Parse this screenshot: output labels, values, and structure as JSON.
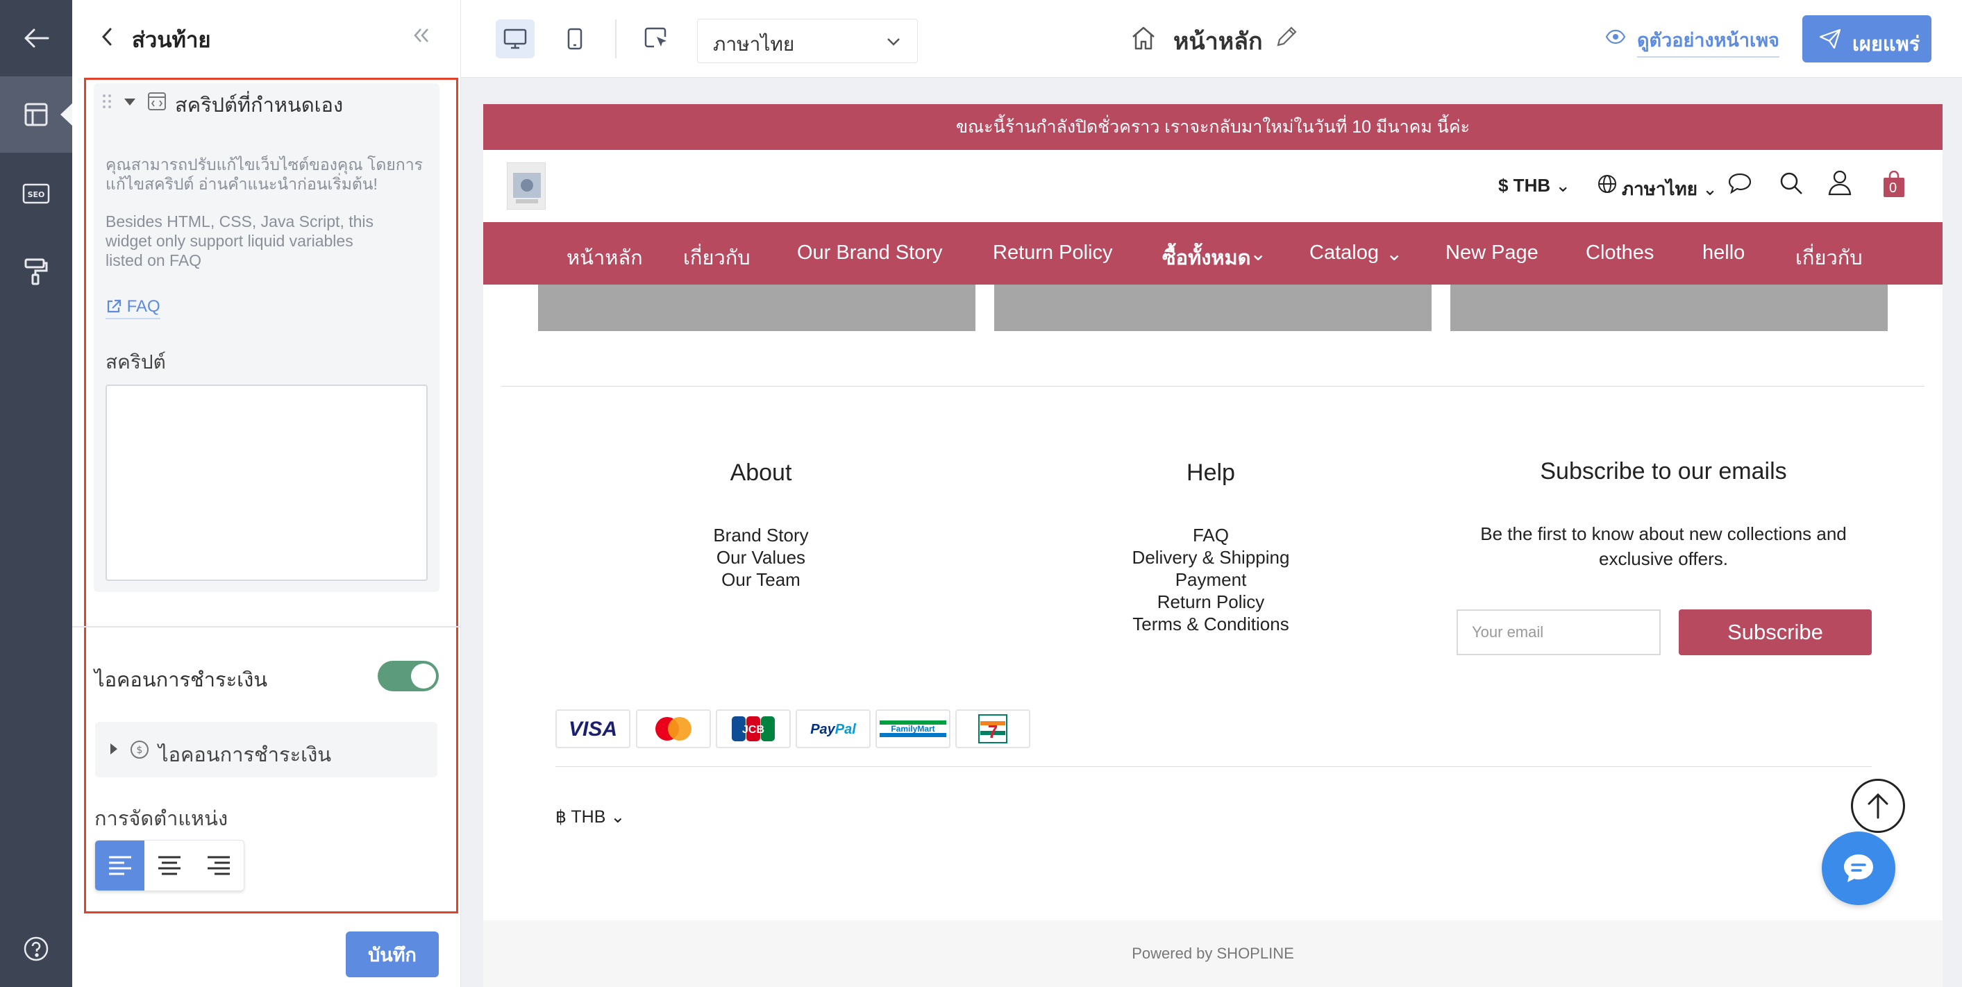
{
  "panel": {
    "title": "ส่วนท้าย",
    "widget_title": "สคริปต์ที่กำหนดเอง",
    "widget_desc_th_1": "คุณสามารถปรับแก้ไขเว็บไซต์ของคุณ โดยการ",
    "widget_desc_th_2": "แก้ไขสคริปต์ อ่านคำแนะนำก่อนเริ่มต้น!",
    "widget_desc_en_1": "Besides HTML, CSS, Java Script, this",
    "widget_desc_en_2": "widget only support liquid variables",
    "widget_desc_en_3": "listed on FAQ",
    "faq_link": "FAQ",
    "script_label": "สคริปต์",
    "script_value": "",
    "payment_toggle_label": "ไอคอนการชำระเงิน",
    "payment_toggle_on": true,
    "payment_accordion_label": "ไอคอนการชำระเงิน",
    "alignment_label": "การจัดตำแหน่ง",
    "alignment_selected": "left",
    "save_label": "บันทึก"
  },
  "toolbar": {
    "language": "ภาษาไทย",
    "page_name": "หน้าหลัก",
    "preview_label": "ดูตัวอย่างหน้าเพจ",
    "publish_label": "เผยแพร่"
  },
  "store": {
    "announcement": "ขณะนี้ร้านกำลังปิดชั่วคราว เราจะกลับมาใหม่ในวันที่ 10 มีนาคม นี้ค่ะ",
    "currency": "$ THB",
    "language": "ภาษาไทย",
    "cart_count": "0",
    "nav": [
      "หน้าหลัก",
      "เกี่ยวกับ",
      "Our Brand Story",
      "Return Policy",
      "ซื้อทั้งหมด",
      "Catalog",
      "New Page",
      "Clothes",
      "hello",
      "เกี่ยวกับ"
    ],
    "footer": {
      "about_title": "About",
      "about_links": [
        "Brand Story",
        "Our Values",
        "Our Team"
      ],
      "help_title": "Help",
      "help_links": [
        "FAQ",
        "Delivery & Shipping",
        "Payment",
        "Return Policy",
        "Terms & Conditions"
      ],
      "subscribe_title": "Subscribe to our emails",
      "subscribe_desc_1": "Be the first to know about new collections and",
      "subscribe_desc_2": "exclusive offers.",
      "email_placeholder": "Your email",
      "subscribe_button": "Subscribe",
      "footer_currency": "฿ THB",
      "powered_by": "Powered by SHOPLINE"
    },
    "payment_icons": [
      "VISA",
      "Mastercard",
      "JCB",
      "PayPal",
      "FamilyMart",
      "7-Eleven"
    ]
  },
  "colors": {
    "brand": "#b84a60",
    "accent": "#5d8be0",
    "toggle": "#5c9c7c",
    "rail": "#3d4454"
  }
}
